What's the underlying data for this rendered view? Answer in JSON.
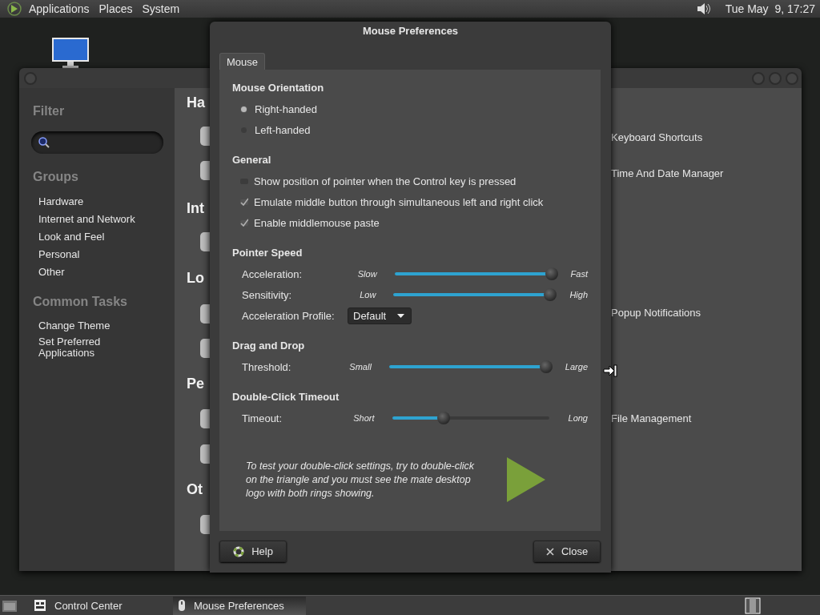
{
  "top_panel": {
    "menus": [
      {
        "label": "Applications"
      },
      {
        "label": "Places"
      },
      {
        "label": "System"
      }
    ],
    "clock": "Tue May  9, 17:27"
  },
  "control_center": {
    "sidebar": {
      "filter_heading": "Filter",
      "groups_heading": "Groups",
      "groups": [
        {
          "label": "Hardware"
        },
        {
          "label": "Internet and Network"
        },
        {
          "label": "Look and Feel"
        },
        {
          "label": "Personal"
        },
        {
          "label": "Other"
        }
      ],
      "tasks_heading": "Common Tasks",
      "tasks": [
        {
          "label": "Change Theme"
        },
        {
          "label": "Set Preferred Applications"
        }
      ]
    },
    "section_headings": [
      {
        "label": "Ha"
      },
      {
        "label": "Int"
      },
      {
        "label": "Lo"
      },
      {
        "label": "Pe"
      },
      {
        "label": "Ot"
      }
    ],
    "items": [
      {
        "label": "Keyboard Shortcuts"
      },
      {
        "label": "Time And Date Manager"
      },
      {
        "label": "Popup Notifications"
      },
      {
        "label": "File Management"
      }
    ]
  },
  "dialog": {
    "title": "Mouse Preferences",
    "tabs": [
      {
        "label": "Mouse",
        "selected": true
      }
    ],
    "sections": [
      {
        "heading": "Mouse Orientation",
        "rows": [
          {
            "kind": "radio",
            "label": "Right-handed",
            "selected": true
          },
          {
            "kind": "radio",
            "label": "Left-handed",
            "selected": false
          }
        ]
      },
      {
        "heading": "General",
        "rows": [
          {
            "kind": "checkbox",
            "label": "Show position of pointer when the Control key is pressed",
            "checked": false
          },
          {
            "kind": "checkbox",
            "label": "Emulate middle button through simultaneous left and right click",
            "checked": true
          },
          {
            "kind": "checkbox",
            "label": "Enable middlemouse paste",
            "checked": true
          }
        ]
      },
      {
        "heading": "Pointer Speed",
        "rows": [
          {
            "kind": "slider",
            "label": "Acceleration:",
            "min_label": "Slow",
            "max_label": "Fast",
            "level": 1
          },
          {
            "kind": "slider",
            "label": "Sensitivity:",
            "min_label": "Low",
            "max_label": "High",
            "level": 1
          },
          {
            "kind": "dropdown",
            "label": "Acceleration Profile:",
            "value": "Default"
          }
        ]
      },
      {
        "heading": "Drag and Drop",
        "rows": [
          {
            "kind": "slider",
            "label": "Threshold:",
            "min_label": "Small",
            "max_label": "Large",
            "level": 1
          }
        ]
      },
      {
        "heading": "Double-Click Timeout",
        "rows": [
          {
            "kind": "slider",
            "label": "Timeout:",
            "min_label": "Short",
            "max_label": "Long",
            "level": 0.33
          }
        ]
      }
    ],
    "hint": "To test your double-click settings, try to double-click on the triangle and you must see the mate desktop logo with both rings showing.",
    "buttons": [
      {
        "kind": "help",
        "label": "Help"
      },
      {
        "kind": "close",
        "label": "Close"
      }
    ]
  },
  "taskbar": {
    "items": [
      {
        "label": "Control Center",
        "selected": false
      },
      {
        "label": "Mouse Preferences",
        "selected": true
      }
    ]
  }
}
